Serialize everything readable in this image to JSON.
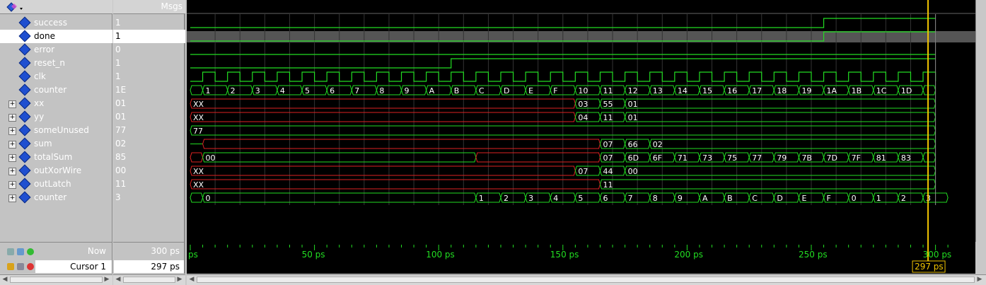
{
  "header": {
    "msgs_label": "Msgs",
    "toolbar_icon": "signal-group-icon"
  },
  "signals": [
    {
      "name": "success",
      "value": "1",
      "expandable": false,
      "selected": false
    },
    {
      "name": "done",
      "value": "1",
      "expandable": false,
      "selected": true
    },
    {
      "name": "error",
      "value": "0",
      "expandable": false,
      "selected": false
    },
    {
      "name": "reset_n",
      "value": "1",
      "expandable": false,
      "selected": false
    },
    {
      "name": "clk",
      "value": "1",
      "expandable": false,
      "selected": false
    },
    {
      "name": "counter",
      "value": "1E",
      "expandable": false,
      "selected": false
    },
    {
      "name": "xx",
      "value": "01",
      "expandable": true,
      "selected": false
    },
    {
      "name": "yy",
      "value": "01",
      "expandable": true,
      "selected": false
    },
    {
      "name": "someUnused",
      "value": "77",
      "expandable": true,
      "selected": false
    },
    {
      "name": "sum",
      "value": "02",
      "expandable": true,
      "selected": false
    },
    {
      "name": "totalSum",
      "value": "85",
      "expandable": true,
      "selected": false
    },
    {
      "name": "outXorWire",
      "value": "00",
      "expandable": true,
      "selected": false
    },
    {
      "name": "outLatch",
      "value": "11",
      "expandable": true,
      "selected": false
    },
    {
      "name": "counter",
      "value": "3",
      "expandable": true,
      "selected": false
    }
  ],
  "waves": {
    "counter_main": [
      "1",
      "2",
      "3",
      "4",
      "5",
      "6",
      "7",
      "8",
      "9",
      "A",
      "B",
      "C",
      "D",
      "E",
      "F",
      "10",
      "11",
      "12",
      "13",
      "14",
      "15",
      "16",
      "17",
      "18",
      "19",
      "1A",
      "1B",
      "1C",
      "1D"
    ],
    "xx": [
      {
        "t": "XX"
      },
      {
        "t": "03"
      },
      {
        "t": "55"
      },
      {
        "t": "01"
      }
    ],
    "yy": [
      {
        "t": "XX"
      },
      {
        "t": "04"
      },
      {
        "t": "11"
      },
      {
        "t": "01"
      }
    ],
    "someUnused": [
      {
        "t": "77"
      }
    ],
    "sum": [
      {
        "t": "07"
      },
      {
        "t": "66"
      },
      {
        "t": "02"
      }
    ],
    "totalSum": [
      "00",
      "07",
      "6D",
      "6F",
      "71",
      "73",
      "75",
      "77",
      "79",
      "7B",
      "7D",
      "7F",
      "81",
      "83"
    ],
    "outXorWire": [
      {
        "t": "XX"
      },
      {
        "t": "07"
      },
      {
        "t": "44"
      },
      {
        "t": "00"
      }
    ],
    "outLatch": [
      {
        "t": "XX"
      },
      {
        "t": "11"
      }
    ],
    "counter_sub": [
      "0",
      "1",
      "2",
      "3",
      "4",
      "5",
      "6",
      "7",
      "8",
      "9",
      "A",
      "B",
      "C",
      "D",
      "E",
      "F",
      "0",
      "1",
      "2",
      "3"
    ]
  },
  "timeline": {
    "now_label": "Now",
    "now_value": "300 ps",
    "cursor_label": "Cursor 1",
    "cursor_value": "297 ps",
    "cursor_flag": "297 ps",
    "ticks": [
      "ps",
      "50 ps",
      "100 ps",
      "150 ps",
      "200 ps",
      "250 ps",
      "300 ps"
    ]
  },
  "colors": {
    "wave": "#22dd22",
    "unknown": "#dd2222",
    "bus_text": "#ffffff",
    "cursor": "#f0c400",
    "grid": "#333333",
    "selected_band": "#555555"
  }
}
